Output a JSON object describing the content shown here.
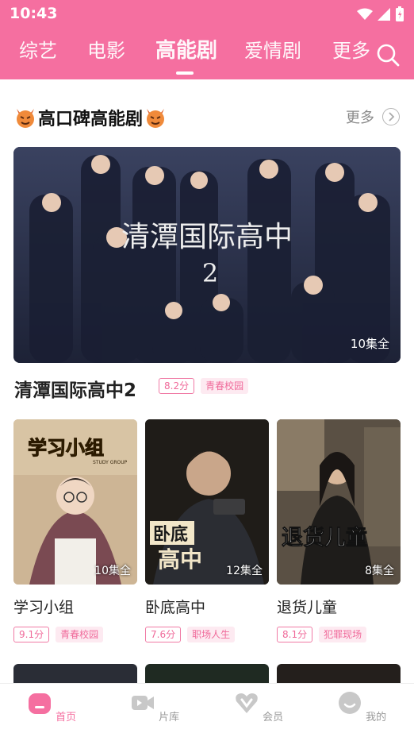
{
  "status_bar": {
    "time": "10:43"
  },
  "tabs": [
    {
      "label": "综艺"
    },
    {
      "label": "电影"
    },
    {
      "label": "高能剧"
    },
    {
      "label": "爱情剧"
    },
    {
      "label": "更多"
    }
  ],
  "active_tab": "高能剧",
  "section": {
    "title": "高口碑高能剧",
    "more": "更多"
  },
  "hero": {
    "title": "清潭国际高中2",
    "episodes": "10集全",
    "score": "8.2分",
    "genre": "青春校园",
    "poster_text": "清潭国际高中",
    "poster_number": "2"
  },
  "cards": [
    {
      "title": "学习小组",
      "episodes": "10集全",
      "score": "9.1分",
      "genre": "青春校园",
      "poster_text": "学习小组",
      "poster_sub": "STUDY GROUP"
    },
    {
      "title": "卧底高中",
      "episodes": "12集全",
      "score": "7.6分",
      "genre": "职场人生",
      "poster_text_1": "卧底",
      "poster_text_2": "高中"
    },
    {
      "title": "退货儿童",
      "episodes": "8集全",
      "score": "8.1分",
      "genre": "犯罪现场",
      "poster_text": "退货儿童"
    }
  ],
  "bottom_nav": [
    {
      "label": "首页",
      "icon": "home-icon",
      "active": true
    },
    {
      "label": "片库",
      "icon": "video-library-icon",
      "active": false
    },
    {
      "label": "会员",
      "icon": "vip-heart-icon",
      "active": false
    },
    {
      "label": "我的",
      "icon": "profile-face-icon",
      "active": false
    }
  ],
  "colors": {
    "brand": "#f56fa0",
    "tag_text": "#f06a9a",
    "tag_bg": "#fdeaf1"
  }
}
